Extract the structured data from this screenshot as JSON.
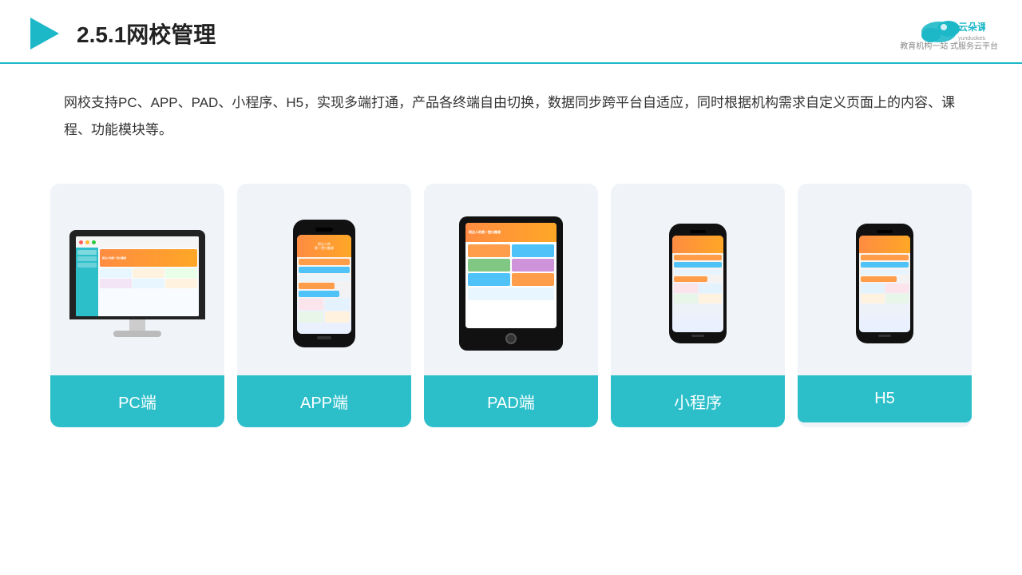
{
  "header": {
    "title_number": "2.5.1",
    "title_text": "网校管理",
    "logo_name": "云朵课堂",
    "logo_sub": "yunduoketang.com",
    "logo_tagline": "教育机构一站\n式服务云平台"
  },
  "description": {
    "text": "网校支持PC、APP、PAD、小程序、H5，实现多端打通，产品各终端自由切换，数据同步跨平台自适应，同时根据机构需求自定义页面上的内容、课程、功能模块等。"
  },
  "cards": [
    {
      "id": "pc",
      "label": "PC端"
    },
    {
      "id": "app",
      "label": "APP端"
    },
    {
      "id": "pad",
      "label": "PAD端"
    },
    {
      "id": "miniprogram",
      "label": "小程序"
    },
    {
      "id": "h5",
      "label": "H5"
    }
  ],
  "colors": {
    "teal": "#2cbfca",
    "accent_blue": "#1db8c8",
    "orange": "#ff8c42",
    "card_bg": "#f0f4f8"
  }
}
